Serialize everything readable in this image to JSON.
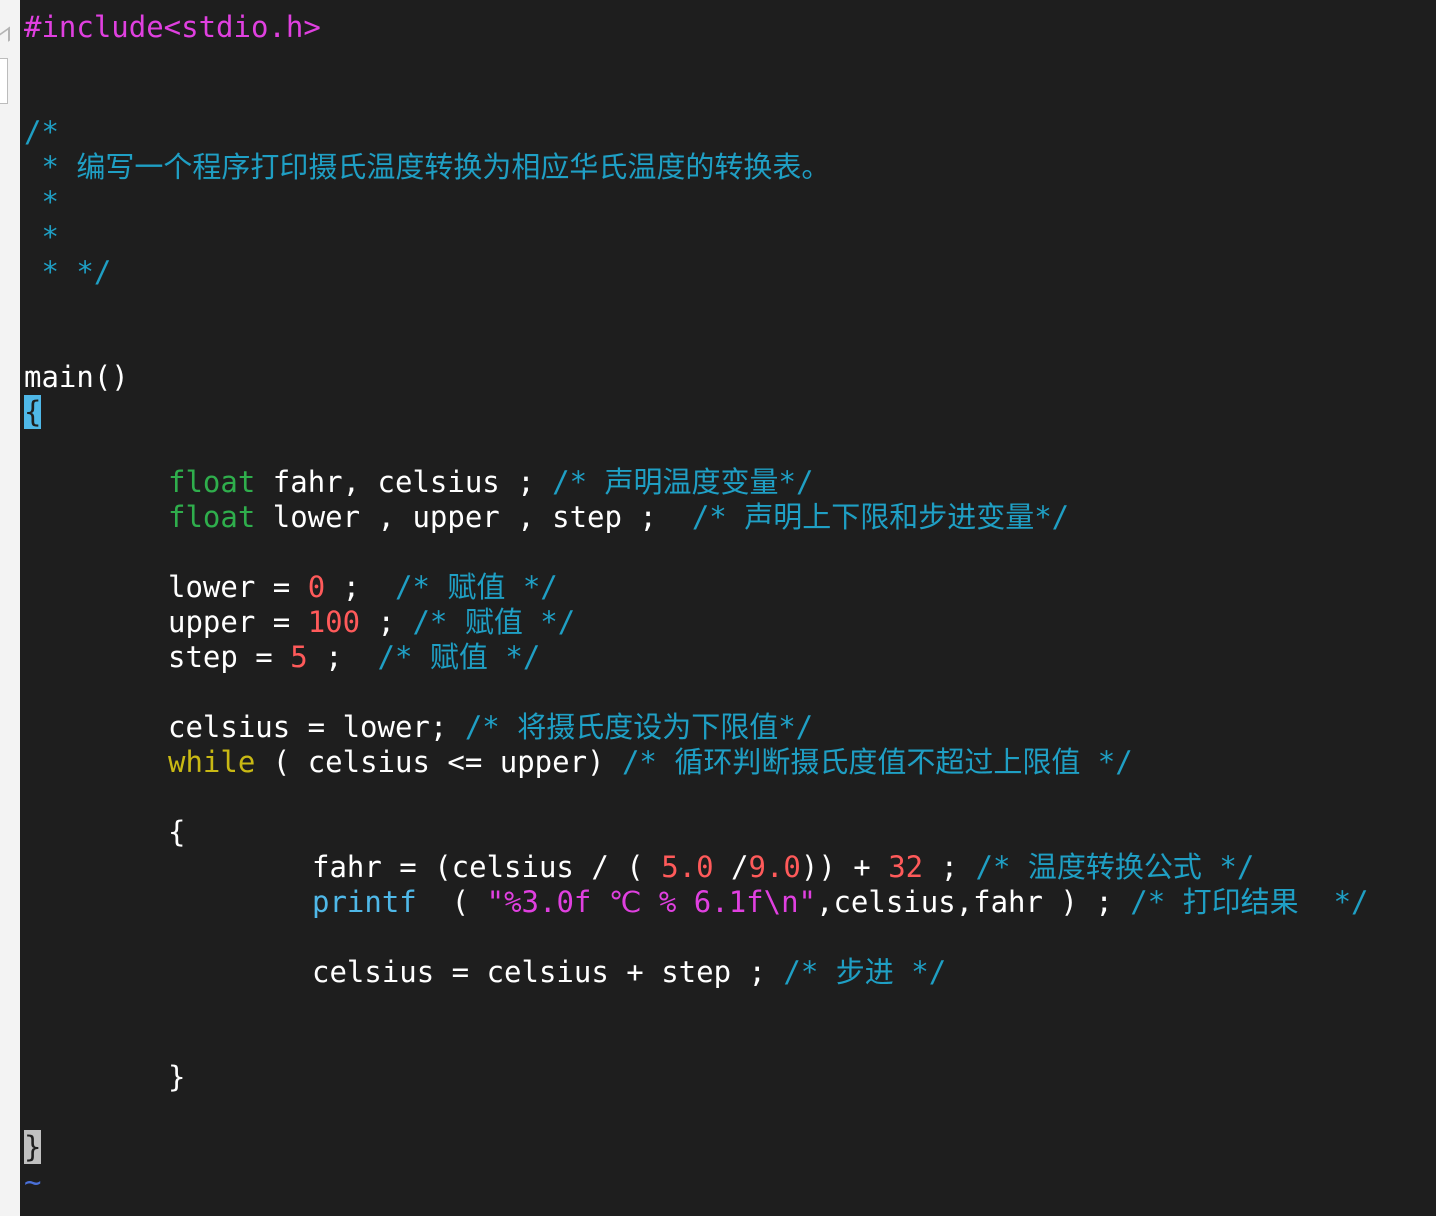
{
  "editor": {
    "line_01": "#include<stdio.h>",
    "line_04": "/*",
    "line_05": " * 编写一个程序打印摄氏温度转换为相应华氏温度的转换表。",
    "line_06": " *",
    "line_07": " *",
    "line_08": " * */",
    "line_11": "main()",
    "line_12_brace": "{",
    "line_14_type": "float",
    "line_14_code": " fahr, celsius ; ",
    "line_14_comment": "/* 声明温度变量*/",
    "line_15_type": "float",
    "line_15_code": " lower , upper , step ;  ",
    "line_15_comment": "/* 声明上下限和步进变量*/",
    "line_17_a": "lower = ",
    "line_17_num": "0",
    "line_17_b": " ;  ",
    "line_17_comment": "/* 赋值 */",
    "line_18_a": "upper = ",
    "line_18_num": "100",
    "line_18_b": " ; ",
    "line_18_comment": "/* 赋值 */",
    "line_19_a": "step = ",
    "line_19_num": "5",
    "line_19_b": " ;  ",
    "line_19_comment": "/* 赋值 */",
    "line_21_code": "celsius = lower; ",
    "line_21_comment": "/* 将摄氏度设为下限值*/",
    "line_22_kw": "while",
    "line_22_code": " ( celsius <= upper) ",
    "line_22_comment": "/* 循环判断摄氏度值不超过上限值 */",
    "line_24_brace": "{",
    "line_25_a": "fahr = (celsius / ( ",
    "line_25_num1": "5.0",
    "line_25_b": " /",
    "line_25_num2": "9.0",
    "line_25_c": ")) + ",
    "line_25_num3": "32",
    "line_25_d": " ; ",
    "line_25_comment": "/* 温度转换公式 */",
    "line_26_fn": "printf",
    "line_26_a": "  ( ",
    "line_26_str": "\"%3.0f ℃ % 6.1f\\n\"",
    "line_26_b": ",celsius,fahr ) ; ",
    "line_26_comment": "/* 打印结果  */",
    "line_28_a": "celsius = celsius + step ; ",
    "line_28_comment": "/* 步进 */",
    "line_31_brace": "}",
    "line_33_brace": "}",
    "line_34_tilde": "~"
  }
}
